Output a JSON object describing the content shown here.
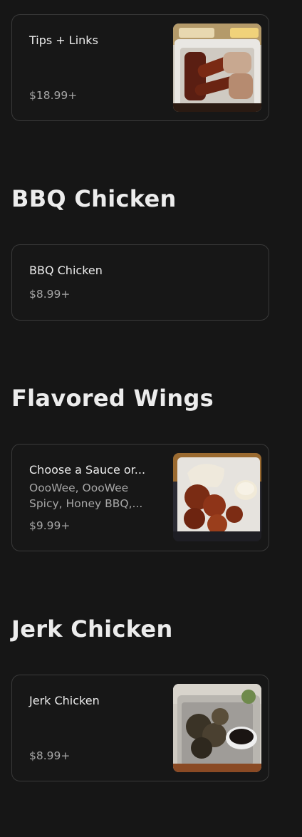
{
  "sections": [
    {
      "items": [
        {
          "name": "Tips + Links",
          "price": "$18.99+"
        }
      ]
    },
    {
      "title": "BBQ Chicken",
      "items": [
        {
          "name": "BBQ Chicken",
          "price": "$8.99+"
        }
      ]
    },
    {
      "title": "Flavored Wings",
      "items": [
        {
          "name": "Choose a Sauce or...",
          "description_lines": [
            "OooWee, OooWee",
            "Spicy, Honey BBQ,..."
          ],
          "price": "$9.99+"
        }
      ]
    },
    {
      "title": "Jerk Chicken",
      "items": [
        {
          "name": "Jerk Chicken",
          "price": "$8.99+"
        }
      ]
    }
  ]
}
